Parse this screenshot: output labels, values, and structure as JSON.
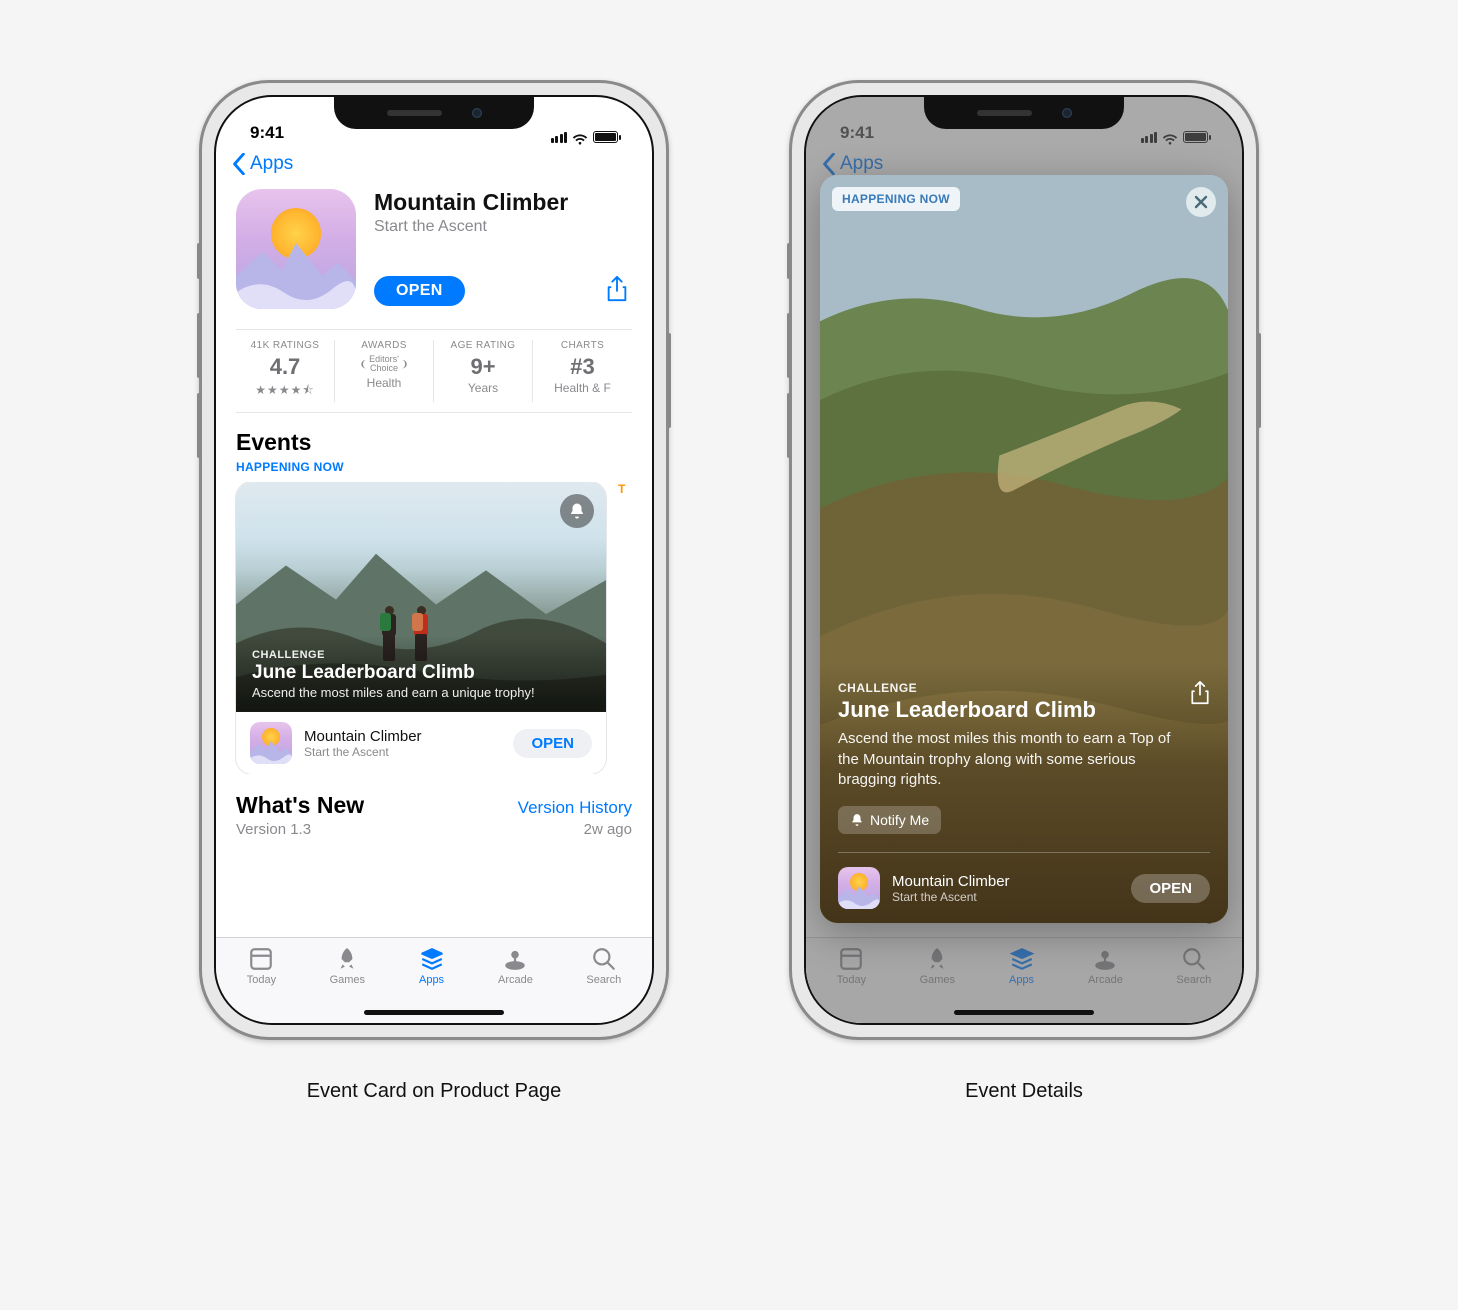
{
  "captions": {
    "left": "Event Card on Product Page",
    "right": "Event Details"
  },
  "status": {
    "time": "9:41"
  },
  "nav": {
    "back": "Apps"
  },
  "app": {
    "name": "Mountain Climber",
    "subtitle": "Start the Ascent",
    "open": "OPEN"
  },
  "stats": {
    "ratings": {
      "label": "41K RATINGS",
      "value": "4.7",
      "sub_stars": "★★★★⯪"
    },
    "awards": {
      "label": "AWARDS",
      "badge_top": "Editors'",
      "badge_bot": "Choice",
      "sub": "Health"
    },
    "age": {
      "label": "AGE RATING",
      "value": "9+",
      "sub": "Years"
    },
    "charts": {
      "label": "CHARTS",
      "value": "#3",
      "sub": "Health & F"
    }
  },
  "events": {
    "section": "Events",
    "badge": "HAPPENING NOW",
    "peek_badge": "T",
    "card": {
      "kicker": "CHALLENGE",
      "title": "June Leaderboard Climb",
      "desc": "Ascend the most miles and earn a unique trophy!",
      "footer_open": "OPEN"
    }
  },
  "whats_new": {
    "title": "What's New",
    "link": "Version History",
    "version": "Version 1.3",
    "ago": "2w ago"
  },
  "tabs": {
    "today": "Today",
    "games": "Games",
    "apps": "Apps",
    "arcade": "Arcade",
    "search": "Search"
  },
  "modal": {
    "pill": "HAPPENING NOW",
    "kicker": "CHALLENGE",
    "title": "June Leaderboard Climb",
    "desc": "Ascend the most miles this month to earn a Top of the Mountain trophy along with some serious bragging rights.",
    "notify": "Notify Me",
    "open": "OPEN"
  }
}
